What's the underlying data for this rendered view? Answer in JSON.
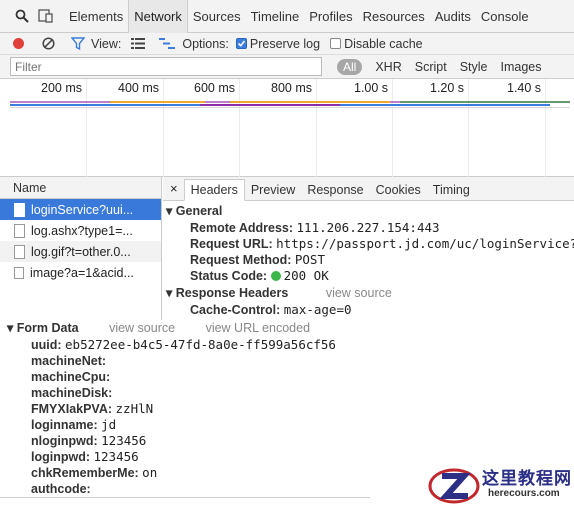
{
  "tabs": [
    "Elements",
    "Network",
    "Sources",
    "Timeline",
    "Profiles",
    "Resources",
    "Audits",
    "Console"
  ],
  "toolbar": {
    "view_label": "View:",
    "options_label": "Options:",
    "preserve_log": "Preserve log",
    "disable_cache": "Disable cache"
  },
  "filter": {
    "placeholder": "Filter",
    "all": "All",
    "types": [
      "XHR",
      "Script",
      "Style",
      "Images"
    ]
  },
  "timeline": {
    "ticks": [
      "200 ms",
      "400 ms",
      "600 ms",
      "800 ms",
      "1.00 s",
      "1.20 s",
      "1.40 s"
    ],
    "colors": {
      "blue": "#3b7ddd",
      "orange": "#f0a83c",
      "purple": "#8c2ea8",
      "green": "#43a047"
    }
  },
  "requests": {
    "header": "Name",
    "items": [
      {
        "name": "loginService?uui...",
        "selected": true
      },
      {
        "name": "log.ashx?type1=..."
      },
      {
        "name": "log.gif?t=other.0..."
      },
      {
        "name": "image?a=1&acid..."
      }
    ]
  },
  "detail": {
    "tabs": [
      "Headers",
      "Preview",
      "Response",
      "Cookies",
      "Timing"
    ],
    "general": {
      "title": "General",
      "remote_k": "Remote Address:",
      "remote_v": "111.206.227.154:443",
      "url_k": "Request URL:",
      "url_v": "https://passport.jd.com/uc/loginService?uu",
      "method_k": "Request Method:",
      "method_v": "POST",
      "status_k": "Status Code:",
      "status_v": "200 OK"
    },
    "response_headers": {
      "title": "Response Headers",
      "view_source": "view source",
      "cc_k": "Cache-Control:",
      "cc_v": "max-age=0"
    }
  },
  "form_data": {
    "title": "Form Data",
    "view_source": "view source",
    "view_url_encoded": "view URL encoded",
    "fields": [
      {
        "k": "uuid:",
        "v": "eb5272ee-b4c5-47fd-8a0e-ff599a56cf56"
      },
      {
        "k": "machineNet:",
        "v": ""
      },
      {
        "k": "machineCpu:",
        "v": ""
      },
      {
        "k": "machineDisk:",
        "v": ""
      },
      {
        "k": "FMYXIakPVA:",
        "v": "zzHlN"
      },
      {
        "k": "loginname:",
        "v": "jd"
      },
      {
        "k": "nloginpwd:",
        "v": "123456"
      },
      {
        "k": "loginpwd:",
        "v": "123456"
      },
      {
        "k": "chkRememberMe:",
        "v": "on"
      },
      {
        "k": "authcode:",
        "v": ""
      }
    ]
  },
  "watermark": {
    "title": "这里教程网",
    "url": "herecours.com"
  }
}
